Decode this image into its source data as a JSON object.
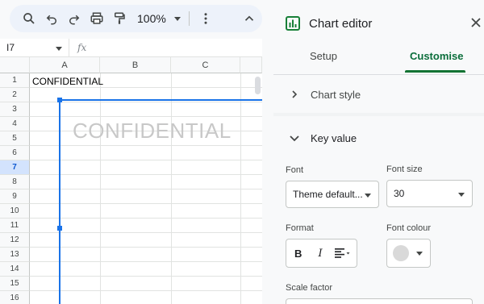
{
  "toolbar": {
    "zoom_value": "100%",
    "icons": [
      "search-icon",
      "undo-icon",
      "redo-icon",
      "print-icon",
      "paint-format-icon",
      "more-vert-icon",
      "collapse-icon"
    ]
  },
  "formula_bar": {
    "cell_ref": "I7",
    "fx_label": "fx"
  },
  "sheet": {
    "columns": [
      "A",
      "B",
      "C"
    ],
    "rows": [
      "1",
      "2",
      "3",
      "4",
      "5",
      "6",
      "7",
      "8",
      "9",
      "10",
      "11",
      "12",
      "13",
      "14",
      "15",
      "16"
    ],
    "selected_row": "7",
    "cell_a1": "CONFIDENTIAL"
  },
  "chart": {
    "key_value_text": "CONFIDENTIAL",
    "text_color": "#c8c8c8"
  },
  "editor": {
    "title": "Chart editor",
    "tabs": {
      "setup": "Setup",
      "customise": "Customise"
    },
    "active_tab": "customise",
    "sections": {
      "chart_style": "Chart style",
      "key_value": "Key value"
    },
    "font": {
      "label": "Font",
      "value": "Theme default..."
    },
    "font_size": {
      "label": "Font size",
      "value": "30"
    },
    "format": {
      "label": "Format",
      "bold": "B",
      "italic": "I"
    },
    "font_colour": {
      "label": "Font colour",
      "value": "#d9d9d9"
    },
    "scale_factor": {
      "label": "Scale factor"
    },
    "accent_color": "#137333"
  }
}
